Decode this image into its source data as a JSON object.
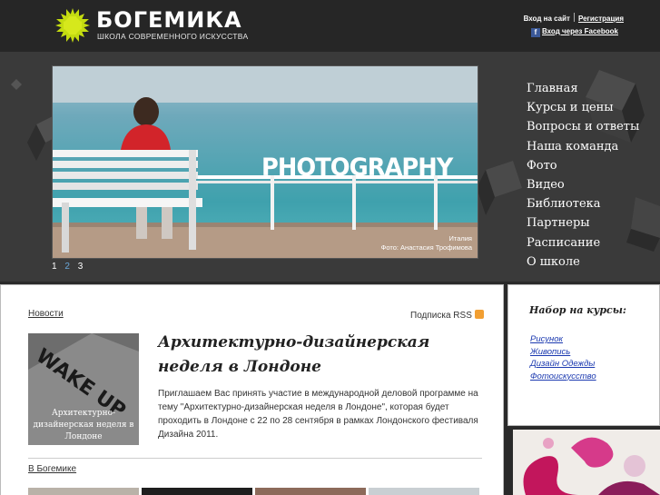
{
  "brand": {
    "name": "БОГЕМИКА",
    "tagline": "ШКОЛА СОВРЕМЕННОГО ИСКУССТВА"
  },
  "auth": {
    "login": "Вход на сайт",
    "register": "Регистрация",
    "facebook": "Вход через Facebook"
  },
  "slider": {
    "title": "PHOTOGRAPHY",
    "caption_place": "Италия",
    "caption_photo": "Фото: Анастасия Трофимова",
    "pages": [
      "1",
      "2",
      "3"
    ]
  },
  "nav": [
    "Главная",
    "Курсы и цены",
    "Вопросы и ответы",
    "Наша команда",
    "Фото",
    "Видео",
    "Библиотека",
    "Партнеры",
    "Расписание",
    "О школе"
  ],
  "news": {
    "section_link": "Новости",
    "rss": "Подписка RSS",
    "thumb_caption": "Архитектурно-дизайнерская неделя в Лондоне",
    "thumb_text": "WAKE UP",
    "article_title": "Архитектурно-дизайнерская неделя в Лондоне",
    "article_body": "Приглашаем Вас принять участие в международной деловой программе на тему \"Архитектурно-дизайнерская неделя в Лондоне\", которая будет проходить в Лондоне с 22 по 28 сентября в рамках Лондонского фестиваля Дизайна 2011.",
    "bottom_link": "В Богемике"
  },
  "courses": {
    "title": "Набор на курсы:",
    "items": [
      "Рисунок",
      "Живопись",
      "Дизайн Одежды",
      "Фотоискусство"
    ]
  },
  "colors": {
    "header_bg": "#262626",
    "hero_bg": "#3a3a3a",
    "link_blue": "#1c3ab0",
    "sun_yellow": "#d6e81c"
  }
}
